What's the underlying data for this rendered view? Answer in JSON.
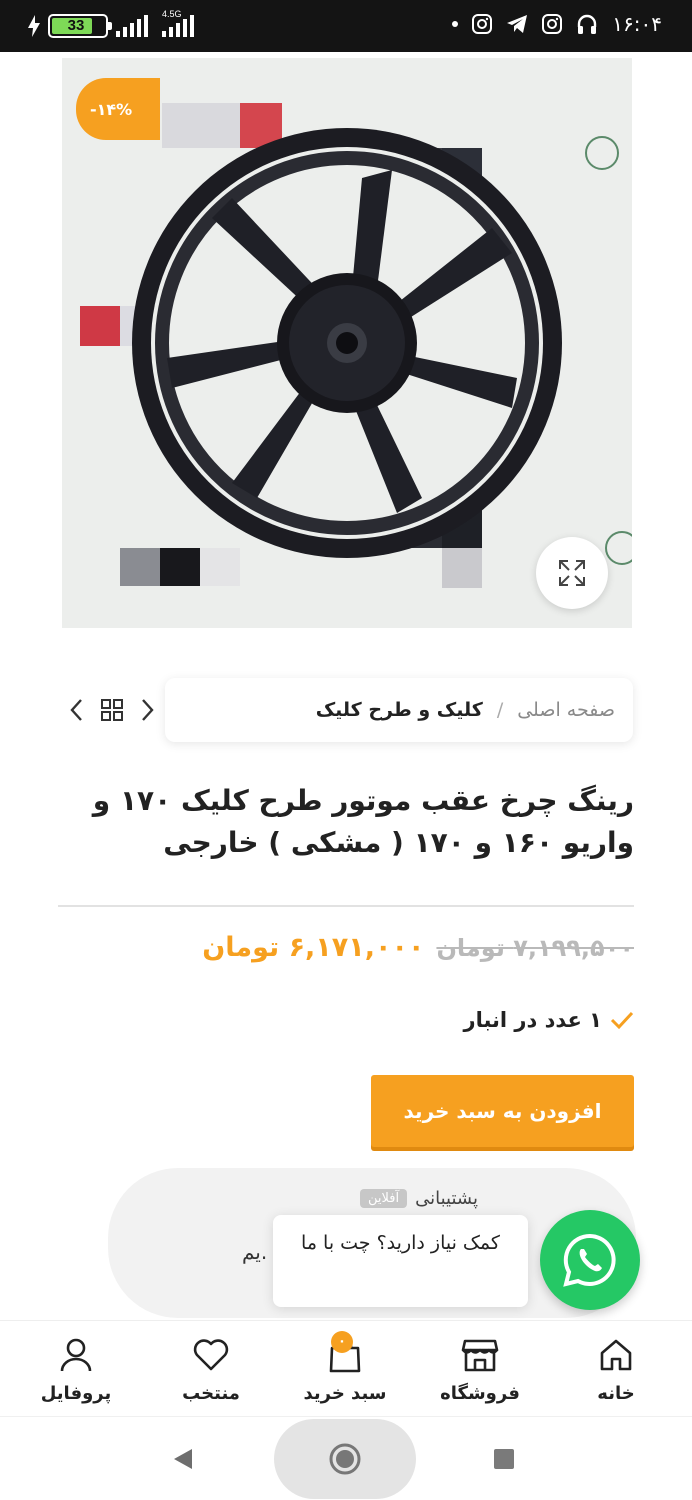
{
  "status_bar": {
    "time": "۱۶:۰۴",
    "battery": "33",
    "network": "4.5G"
  },
  "product": {
    "discount_badge": "-۱۴%",
    "title": "رینگ چرخ عقب موتور طرح کلیک ۱۷۰ و واریو ۱۶۰ و ۱۷۰ ( مشکی ) خارجی",
    "old_price": "۷,۱۹۹,۵۰۰ تومان",
    "new_price": "۶,۱۷۱,۰۰۰ تومان",
    "stock": "۱ عدد در انبار",
    "add_to_cart": "افزودن به سبد خرید"
  },
  "breadcrumb": {
    "home": "صفحه اصلی",
    "separator": "/",
    "current": "کلیک و طرح کلیک"
  },
  "support": {
    "title": "پشتیبانی",
    "status": "آفلاین",
    "partial_text": "یم.",
    "bubble": "کمک نیاز دارید؟ چت با ما"
  },
  "bottom_nav": {
    "home": "خانه",
    "shop": "فروشگاه",
    "cart": "سبد خرید",
    "cart_count": "۰",
    "wishlist": "منتخب",
    "profile": "پروفایل"
  },
  "colors": {
    "accent": "#f6a020",
    "whatsapp": "#25c865",
    "status_bar": "#141414"
  }
}
